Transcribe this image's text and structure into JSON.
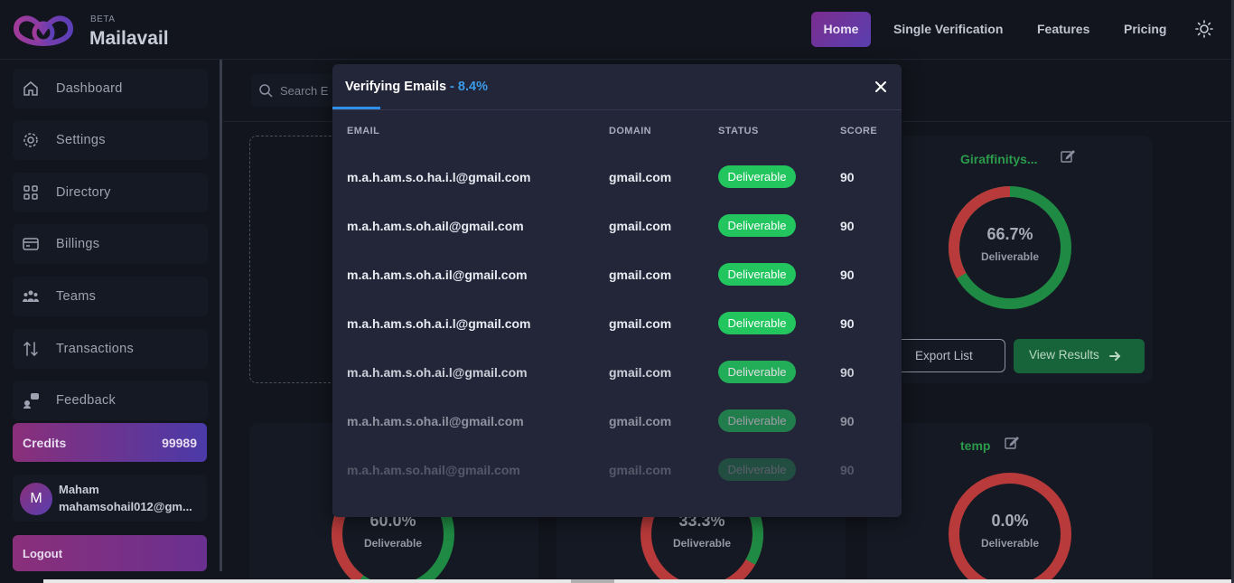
{
  "brand": {
    "beta": "BETA",
    "name": "Mailavail"
  },
  "nav": {
    "home": "Home",
    "single": "Single Verification",
    "features": "Features",
    "pricing": "Pricing"
  },
  "sidebar": {
    "items": [
      {
        "label": "Dashboard",
        "icon": "home-icon"
      },
      {
        "label": "Settings",
        "icon": "gear-icon"
      },
      {
        "label": "Directory",
        "icon": "grid-icon"
      },
      {
        "label": "Billings",
        "icon": "card-icon"
      },
      {
        "label": "Teams",
        "icon": "team-icon"
      },
      {
        "label": "Transactions",
        "icon": "arrows-icon"
      },
      {
        "label": "Feedback",
        "icon": "feedback-icon"
      }
    ],
    "credits_label": "Credits",
    "credits_value": "99989",
    "user_initial": "M",
    "user_name": "Maham",
    "user_email": "mahamsohail012@gm...",
    "logout": "Logout"
  },
  "main": {
    "search_placeholder": "Search E",
    "cards": [
      {
        "title": "Giraffinitys...",
        "pct": "66.7%",
        "sub": "Deliverable"
      },
      {
        "title": "",
        "pct": "60.0%",
        "sub": "Deliverable"
      },
      {
        "title": "",
        "pct": "33.3%",
        "sub": "Deliverable"
      },
      {
        "title": "temp",
        "pct": "0.0%",
        "sub": "Deliverable"
      }
    ],
    "export_label": "Export List",
    "results_label": "View Results"
  },
  "modal": {
    "title": "Verifying Emails",
    "separator": " - ",
    "progress": "8.4%",
    "columns": {
      "email": "EMAIL",
      "domain": "DOMAIN",
      "status": "STATUS",
      "score": "SCORE"
    },
    "rows": [
      {
        "email": "m.a.h.am.s.o.ha.i.l@gmail.com",
        "domain": "gmail.com",
        "status": "Deliverable",
        "score": "90"
      },
      {
        "email": "m.a.h.am.s.oh.ail@gmail.com",
        "domain": "gmail.com",
        "status": "Deliverable",
        "score": "90"
      },
      {
        "email": "m.a.h.am.s.oh.a.il@gmail.com",
        "domain": "gmail.com",
        "status": "Deliverable",
        "score": "90"
      },
      {
        "email": "m.a.h.am.s.oh.a.i.l@gmail.com",
        "domain": "gmail.com",
        "status": "Deliverable",
        "score": "90"
      },
      {
        "email": "m.a.h.am.s.oh.ai.l@gmail.com",
        "domain": "gmail.com",
        "status": "Deliverable",
        "score": "90"
      },
      {
        "email": "m.a.h.am.s.oha.il@gmail.com",
        "domain": "gmail.com",
        "status": "Deliverable",
        "score": "90"
      },
      {
        "email": "m.a.h.am.so.hail@gmail.com",
        "domain": "gmail.com",
        "status": "Deliverable",
        "score": "90"
      }
    ]
  },
  "colors": {
    "accent_blue": "#3a9be8",
    "deliverable_green": "#22c55e",
    "brand_purple": "#8a2f7a"
  }
}
